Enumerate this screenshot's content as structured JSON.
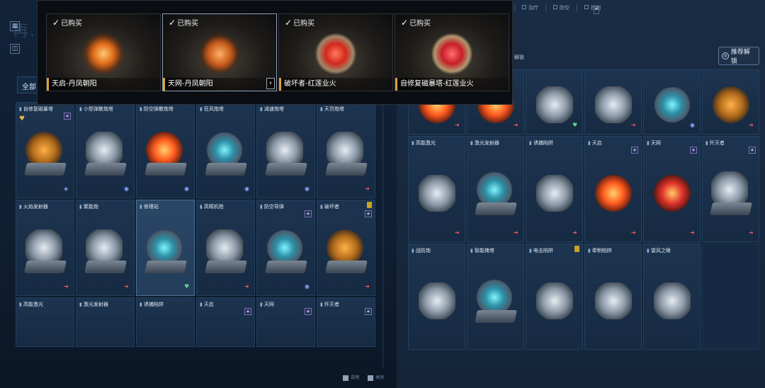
{
  "header": {
    "ghost_title": "再...",
    "filter_tab": "全部",
    "top_tabs": [
      "治疗",
      "防空",
      "控制"
    ],
    "recommend_label": "推荐解锁",
    "unlock_label": "解锁"
  },
  "popup": {
    "skins": [
      {
        "owned": "已购买",
        "name": "天启-丹凤朝阳"
      },
      {
        "owned": "已购买",
        "name": "天网-丹凤朝阳"
      },
      {
        "owned": "已购买",
        "name": "破坏者-红莲业火"
      },
      {
        "owned": "已购买",
        "name": "自修复磁暴塔-红莲业火"
      }
    ]
  },
  "left_grid": {
    "rows": [
      [
        {
          "name": "自修复磁暴塔"
        },
        {
          "name": "小型弹散炮塔"
        },
        {
          "name": "防空弹散炮塔"
        },
        {
          "name": "狂风炮塔"
        },
        {
          "name": "减速炮塔"
        },
        {
          "name": "天罚炮塔"
        }
      ],
      [
        {
          "name": "火焰发射器"
        },
        {
          "name": "聚能炮"
        },
        {
          "name": "修理站"
        },
        {
          "name": "高精机枪"
        },
        {
          "name": "防空导弹"
        },
        {
          "name": "破坏者"
        }
      ],
      [
        {
          "name": "高能激光"
        },
        {
          "name": "激光发射器"
        },
        {
          "name": "诱捕陷阱"
        },
        {
          "name": "天启"
        },
        {
          "name": "天网"
        },
        {
          "name": "歼灭者"
        }
      ]
    ]
  },
  "right_grid": {
    "rows": [
      [
        {
          "name": ""
        },
        {
          "name": ""
        },
        {
          "name": ""
        },
        {
          "name": ""
        },
        {
          "name": ""
        },
        {
          "name": ""
        }
      ],
      [
        {
          "name": "高能激光"
        },
        {
          "name": "激光发射器"
        },
        {
          "name": "诱捕陷阱"
        },
        {
          "name": "天启"
        },
        {
          "name": "天网"
        },
        {
          "name": "歼灭者"
        }
      ],
      [
        {
          "name": "战防炮"
        },
        {
          "name": "智能掩塔"
        },
        {
          "name": "电击陷阱"
        },
        {
          "name": "牵制陷阱"
        },
        {
          "name": "雷风之眼"
        }
      ]
    ]
  },
  "hints": {
    "left": "说明",
    "right": "关闭"
  }
}
